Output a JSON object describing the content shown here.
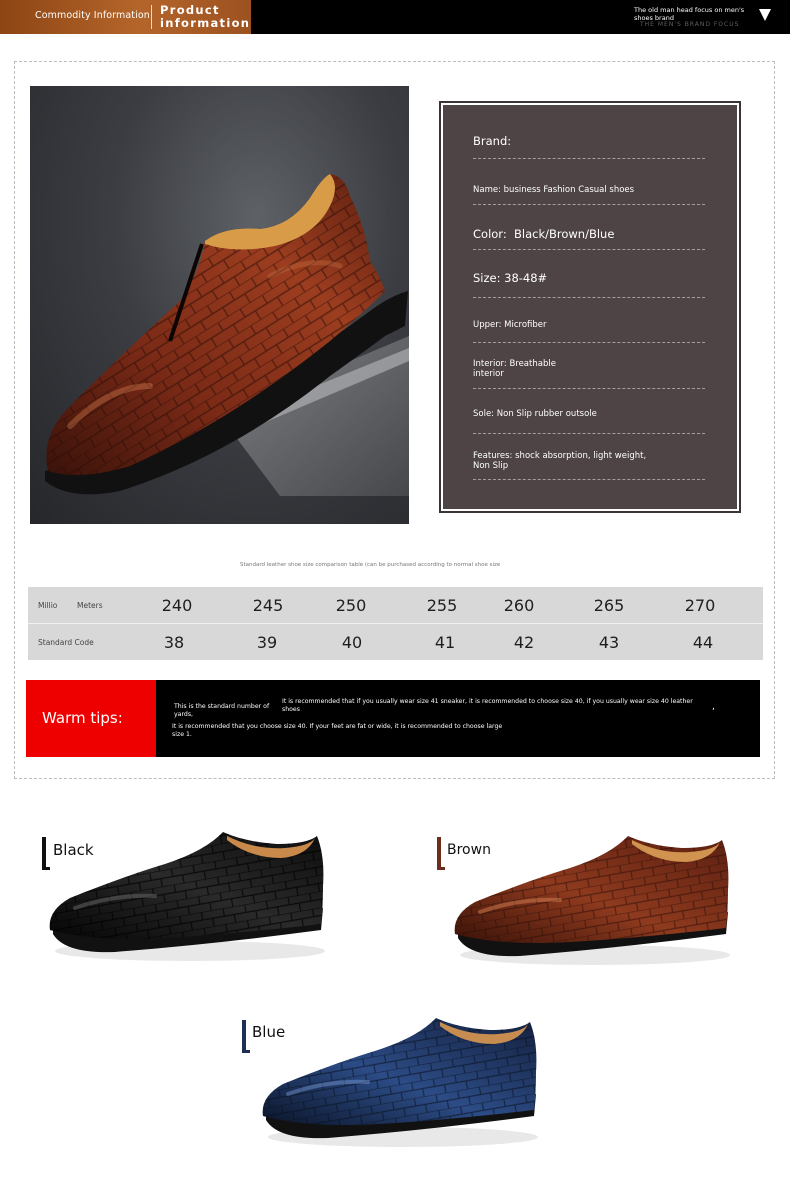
{
  "header": {
    "tab_commodity": "Commodity Information",
    "tab_product": "Product information",
    "brand_note": "The old man head focus on men's shoes brand",
    "brand_watermark": "THE MEN'S BRAND FOCUS",
    "colors": {
      "bar": "#000000",
      "tab": "#a65a22"
    },
    "menu_icon": "triangle-down-icon"
  },
  "hero": {
    "image_subject": "brown crocodile-embossed slip-on shoe"
  },
  "specs": {
    "background_color": "#4e4446",
    "rows": [
      {
        "label": "Brand:",
        "value": ""
      },
      {
        "label": "Name:",
        "value": "business Fashion Casual shoes"
      },
      {
        "label": "Color:",
        "value": "Black/Brown/Blue"
      },
      {
        "label": "Size:",
        "value": "38-48#"
      },
      {
        "label": "Upper:",
        "value": "Microfiber"
      },
      {
        "label": "Interior:",
        "value": "Breathable interior"
      },
      {
        "label": "Sole:",
        "value": "Non Slip rubber outsole"
      },
      {
        "label": "Features:",
        "value": "shock absorption, light weight, Non Slip"
      }
    ]
  },
  "size_table": {
    "caption": "Standard leather shoe size comparison table (can be purchased according to normal shoe size",
    "row1_label_a": "Millio",
    "row1_label_b": "Meters",
    "row2_label": "Standard Code",
    "millimeters": [
      "240",
      "245",
      "250",
      "255",
      "260",
      "265",
      "270"
    ],
    "codes": [
      "38",
      "39",
      "40",
      "41",
      "42",
      "43",
      "44"
    ]
  },
  "warm_tips": {
    "label": "Warm tips:",
    "line1a": "This is the standard number of yards,",
    "line1b": "It is recommended that if you usually wear size 41 sneaker, it is recommended to choose size 40, if you usually wear size 40 leather shoes",
    "comma": ",",
    "line2": "It is recommended that you choose size 40. If your feet are fat or wide, it is recommended to choose large size 1.",
    "colors": {
      "label_bg": "#ef0000",
      "bg": "#000000"
    }
  },
  "variants": [
    {
      "name": "Black",
      "color": "#1a1a1a"
    },
    {
      "name": "Brown",
      "color": "#6b2e1d"
    },
    {
      "name": "Blue",
      "color": "#1e2f55"
    }
  ]
}
